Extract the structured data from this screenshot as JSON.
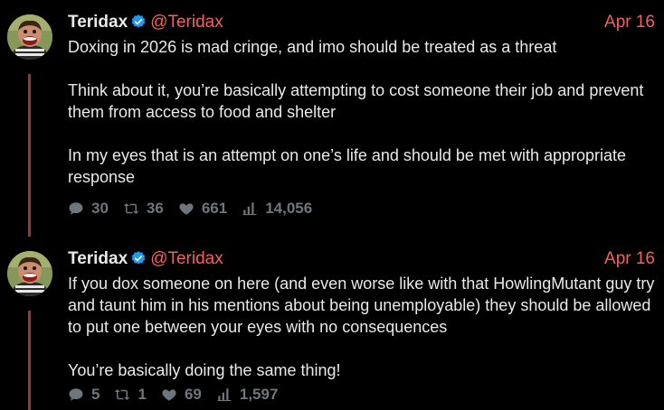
{
  "colors": {
    "background": "#000000",
    "text": "#e7e9ea",
    "accent": "#f4605f",
    "muted": "#6e767d",
    "thread_line": "#8f3a3e",
    "verified": "#1d9bf0"
  },
  "tweets": [
    {
      "author": {
        "display_name": "Teridax",
        "handle": "@Teridax",
        "verified": true
      },
      "date": "Apr 16",
      "paragraphs": [
        "Doxing in 2026 is mad cringe, and imo should be treated as a threat",
        "Think about it, you’re basically attempting to cost someone their job and prevent them from access to food and shelter",
        "In my eyes that is an attempt on one’s life and should be met with appropriate response"
      ],
      "stats": {
        "replies": "30",
        "reposts": "36",
        "likes": "661",
        "views": "14,056"
      }
    },
    {
      "author": {
        "display_name": "Teridax",
        "handle": "@Teridax",
        "verified": true
      },
      "date": "Apr 16",
      "paragraphs": [
        "If you dox someone on here (and even worse like with that HowlingMutant guy try and taunt him in his mentions about being unemployable) they should be allowed to put one between your eyes with no consequences",
        "You’re basically doing the same thing!"
      ],
      "stats": {
        "replies": "5",
        "reposts": "1",
        "likes": "69",
        "views": "1,597"
      }
    }
  ],
  "icons": {
    "reply": "speech-bubble-icon",
    "repost": "repost-icon",
    "like": "heart-icon",
    "views": "bar-chart-icon",
    "verified": "verified-badge-icon"
  }
}
